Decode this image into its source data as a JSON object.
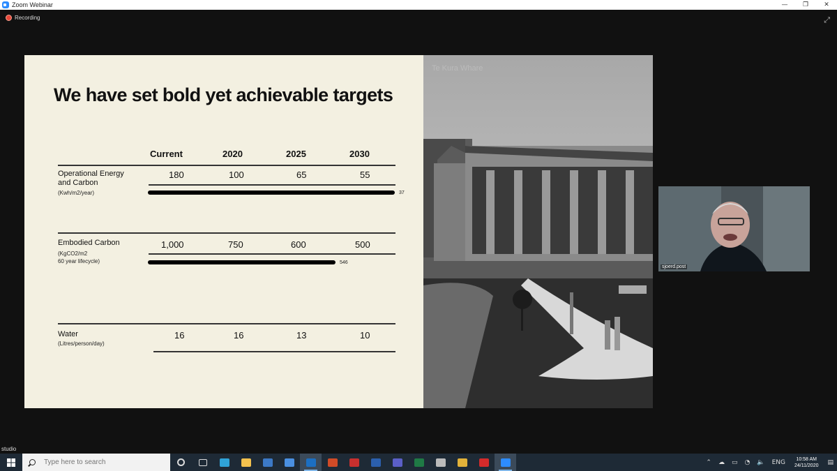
{
  "window": {
    "title": "Zoom Webinar",
    "min": "—",
    "restore": "❐",
    "close": "✕"
  },
  "zoom": {
    "recording": "Recording",
    "expand_glyph": "⤢",
    "presenter_label": "studio"
  },
  "slide": {
    "title": "We have set bold yet achievable targets",
    "columns": [
      "Current",
      "2020",
      "2025",
      "2030"
    ],
    "rows": [
      {
        "label": [
          "Operational Energy",
          "and Carbon"
        ],
        "unit": "(Kwh/m2/year)",
        "values": [
          "180",
          "100",
          "65",
          "55"
        ],
        "bar_value": "37",
        "bar_fraction": 1.0
      },
      {
        "label": [
          "Embodied Carbon"
        ],
        "unit": "(KgCO2/m2",
        "unit2": "60 year lifecycle)",
        "values": [
          "1,000",
          "750",
          "600",
          "500"
        ],
        "bar_value": "546",
        "bar_fraction": 0.76
      },
      {
        "label": [
          "Water"
        ],
        "unit": "(Litres/person/day)",
        "values": [
          "16",
          "16",
          "13",
          "10"
        ]
      }
    ]
  },
  "photo": {
    "caption": "Te Kura Whare"
  },
  "video": {
    "participant": "sjoerd.post"
  },
  "taskbar": {
    "search_placeholder": "Type here to search",
    "time": "10:58 AM",
    "date": "24/11/2020",
    "language": "ENG",
    "apps": [
      {
        "name": "cortana",
        "color": "#1e2a36"
      },
      {
        "name": "task-view",
        "color": "#1e2a36"
      },
      {
        "name": "edge",
        "color": "#2fa3d8"
      },
      {
        "name": "file-explorer",
        "color": "#f2c14e"
      },
      {
        "name": "store",
        "color": "#3c79c6"
      },
      {
        "name": "mail",
        "color": "#4a90e2"
      },
      {
        "name": "outlook",
        "color": "#1c6fc2",
        "active": true
      },
      {
        "name": "powerpoint",
        "color": "#d04b27"
      },
      {
        "name": "acrobat-lock",
        "color": "#c8302e"
      },
      {
        "name": "word",
        "color": "#2b5fad"
      },
      {
        "name": "teams",
        "color": "#5b5fc7"
      },
      {
        "name": "excel",
        "color": "#1f7a45"
      },
      {
        "name": "settings",
        "color": "#bbbbbb"
      },
      {
        "name": "chrome",
        "color": "#e2b23a"
      },
      {
        "name": "acrobat",
        "color": "#d42b2b"
      },
      {
        "name": "zoom",
        "color": "#2d8cff",
        "active": true
      }
    ]
  }
}
